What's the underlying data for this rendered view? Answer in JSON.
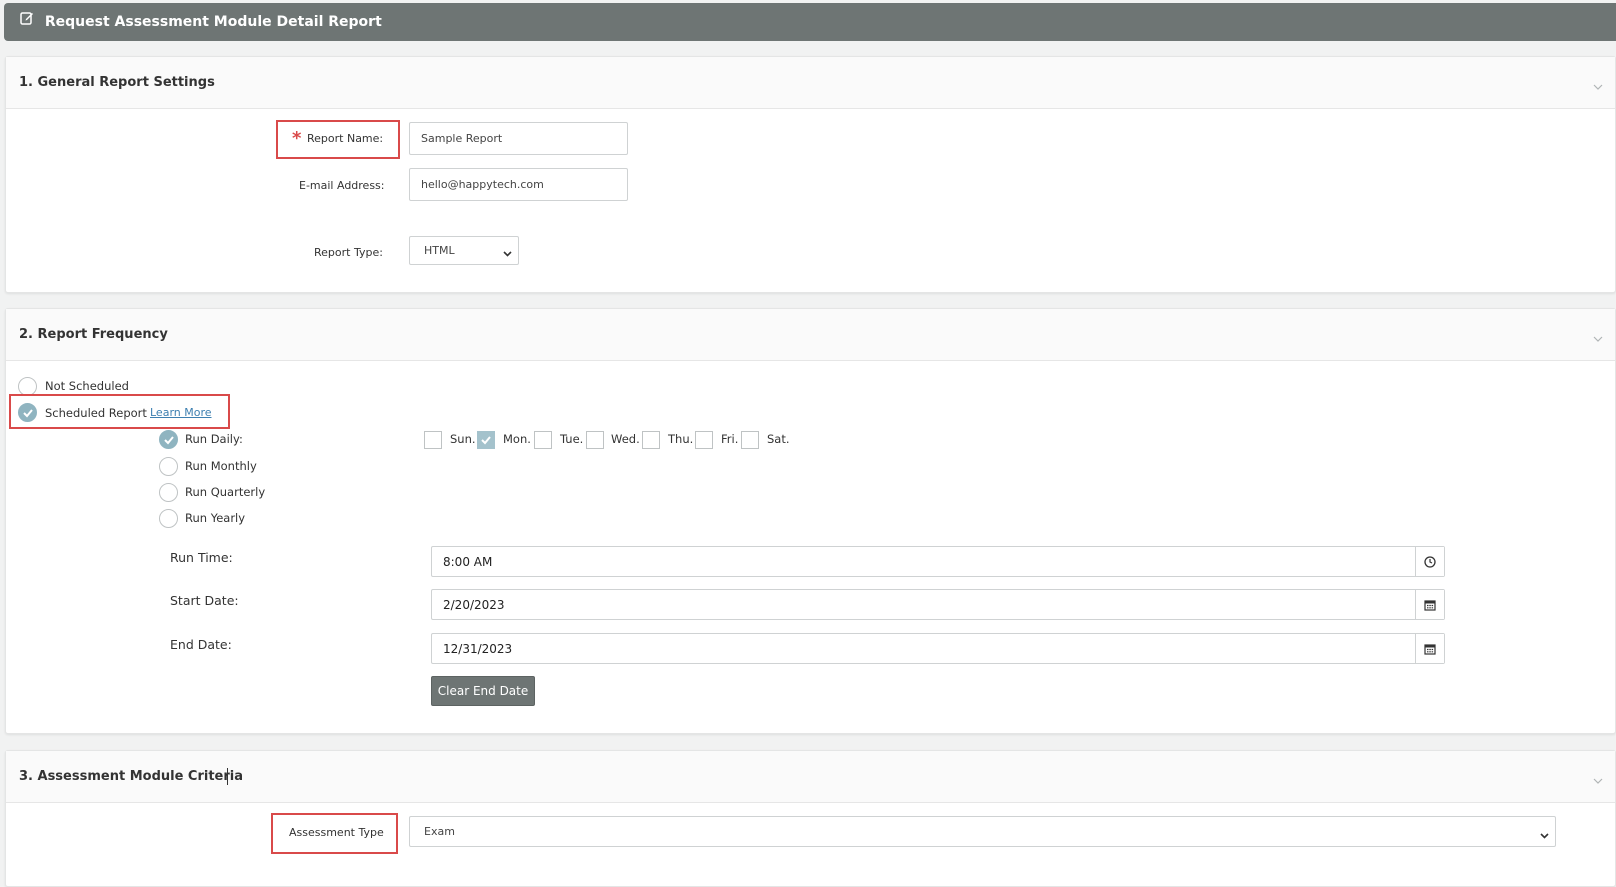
{
  "header": {
    "title": "Request Assessment Module Detail Report"
  },
  "section1": {
    "title": "1. General Report Settings",
    "report_name_label": "Report Name:",
    "report_name_value": "Sample Report",
    "email_label": "E-mail Address:",
    "email_value": "hello@happytech.com",
    "report_type_label": "Report Type:",
    "report_type_value": "HTML"
  },
  "section2": {
    "title": "2. Report Frequency",
    "not_scheduled_label": "Not Scheduled",
    "scheduled_label": "Scheduled Report",
    "learn_more": "Learn More",
    "run_options": [
      "Run Daily:",
      "Run Monthly",
      "Run Quarterly",
      "Run Yearly"
    ],
    "days": [
      {
        "label": "Sun.",
        "checked": false
      },
      {
        "label": "Mon.",
        "checked": true
      },
      {
        "label": "Tue.",
        "checked": false
      },
      {
        "label": "Wed.",
        "checked": false
      },
      {
        "label": "Thu.",
        "checked": false
      },
      {
        "label": "Fri.",
        "checked": false
      },
      {
        "label": "Sat.",
        "checked": false
      }
    ],
    "run_time_label": "Run Time:",
    "run_time_value": "8:00 AM",
    "start_date_label": "Start Date:",
    "start_date_value": "2/20/2023",
    "end_date_label": "End Date:",
    "end_date_value": "12/31/2023",
    "clear_end_date": "Clear End Date"
  },
  "section3": {
    "title": "3. Assessment Module Criteria",
    "assessment_type_label": "Assessment Type",
    "assessment_type_value": "Exam"
  },
  "colors": {
    "header_bg": "#6e7574",
    "highlight": "#d94a4a",
    "checked": "#8fb4c0",
    "link": "#3d7fb0"
  }
}
